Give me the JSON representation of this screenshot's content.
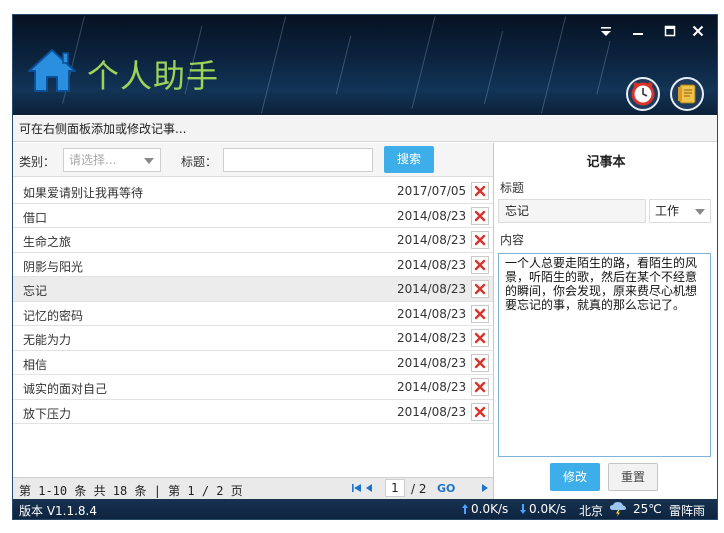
{
  "app": {
    "title": "个人助手",
    "window_controls": [
      "▾",
      "□",
      "✕"
    ],
    "header_buttons": [
      {
        "icon": "clock-icon"
      },
      {
        "icon": "notebook-icon"
      }
    ]
  },
  "hint": "可在右侧面板添加或修改记事...",
  "filter": {
    "category_label": "类别：",
    "category_placeholder": "请选择...",
    "title_label": "标题：",
    "title_value": "",
    "search_label": "搜索"
  },
  "notes": [
    {
      "title": "如果爱请别让我再等待",
      "date": "2017/07/05"
    },
    {
      "title": "借口",
      "date": "2014/08/23"
    },
    {
      "title": "生命之旅",
      "date": "2014/08/23"
    },
    {
      "title": "阴影与阳光",
      "date": "2014/08/23"
    },
    {
      "title": "忘记",
      "date": "2014/08/23",
      "selected": true
    },
    {
      "title": "记忆的密码",
      "date": "2014/08/23"
    },
    {
      "title": "无能为力",
      "date": "2014/08/23"
    },
    {
      "title": "相信",
      "date": "2014/08/23"
    },
    {
      "title": "诚实的面对自己",
      "date": "2014/08/23"
    },
    {
      "title": "放下压力",
      "date": "2014/08/23"
    }
  ],
  "pager": {
    "info": "第 1-10 条  共 18 条  |  第 1 / 2 页",
    "current_page": "1",
    "total": "/ 2",
    "go": "GO"
  },
  "editor": {
    "panel_title": "记事本",
    "title_label": "标题",
    "title_value": "忘记",
    "category_value": "工作",
    "content_label": "内容",
    "content_value": "一个人总要走陌生的路，看陌生的风景，听陌生的歌，然后在某个不经意的瞬间，你会发现，原来费尽心机想要忘记的事，就真的那么忘记了。",
    "edit_label": "修改",
    "reset_label": "重置"
  },
  "status": {
    "version": "版本 V1.1.8.4",
    "upload": "0.0K/s",
    "download": "0.0K/s",
    "city": "北京",
    "temperature": "25℃",
    "weather": "雷阵雨"
  },
  "colors": {
    "accent": "#3daee9",
    "title_green": "#9ed35a",
    "delete_red": "#d9342b"
  }
}
